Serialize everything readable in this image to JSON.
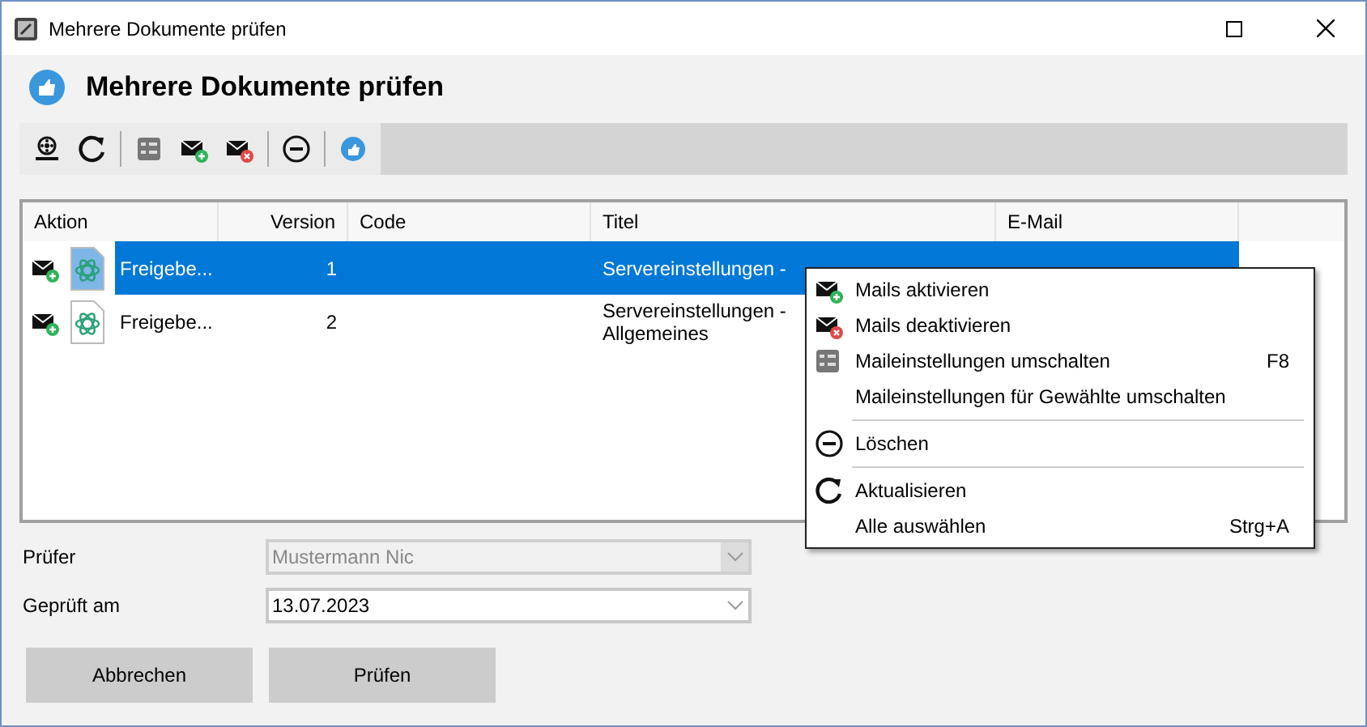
{
  "window": {
    "title": "Mehrere Dokumente prüfen"
  },
  "heading": "Mehrere Dokumente prüfen",
  "toolbar": [
    {
      "kind": "reel"
    },
    {
      "kind": "refresh"
    },
    {
      "kind": "separator"
    },
    {
      "kind": "toggle"
    },
    {
      "kind": "enable"
    },
    {
      "kind": "disable"
    },
    {
      "kind": "separator"
    },
    {
      "kind": "delete"
    },
    {
      "kind": "separator"
    },
    {
      "kind": "approve"
    }
  ],
  "table": {
    "columns": [
      "Aktion",
      "Version",
      "Code",
      "Titel",
      "E-Mail"
    ],
    "rows": [
      {
        "name": "Freigebe...",
        "version": "1",
        "title": "Servereinstellungen -",
        "selected": true
      },
      {
        "name": "Freigebe...",
        "version": "2",
        "title": "Servereinstellungen - Allgemeines",
        "selected": false
      }
    ]
  },
  "context_menu": [
    {
      "kind": "enable",
      "label": "Mails aktivieren",
      "separator_before": false
    },
    {
      "kind": "disable",
      "label": "Mails deaktivieren",
      "separator_before": false
    },
    {
      "kind": "toggle",
      "label": "Maileinstellungen umschalten",
      "shortcut": "F8",
      "separator_before": false
    },
    {
      "kind": "plain",
      "label": "Maileinstellungen für Gewählte umschalten",
      "separator_before": false
    },
    {
      "kind": "delete",
      "label": "Löschen",
      "separator_before": true
    },
    {
      "kind": "refresh",
      "label": "Aktualisieren",
      "separator_before": true
    },
    {
      "kind": "plain",
      "label": "Alle auswählen",
      "shortcut": "Strg+A",
      "separator_before": false
    }
  ],
  "form": {
    "reviewer": {
      "label": "Prüfer",
      "value": "Mustermann Nic",
      "disabled": true
    },
    "date": {
      "label": "Geprüft am",
      "value": "13.07.2023",
      "disabled": false
    }
  },
  "buttons": [
    "Abbrechen",
    "Prüfen"
  ]
}
